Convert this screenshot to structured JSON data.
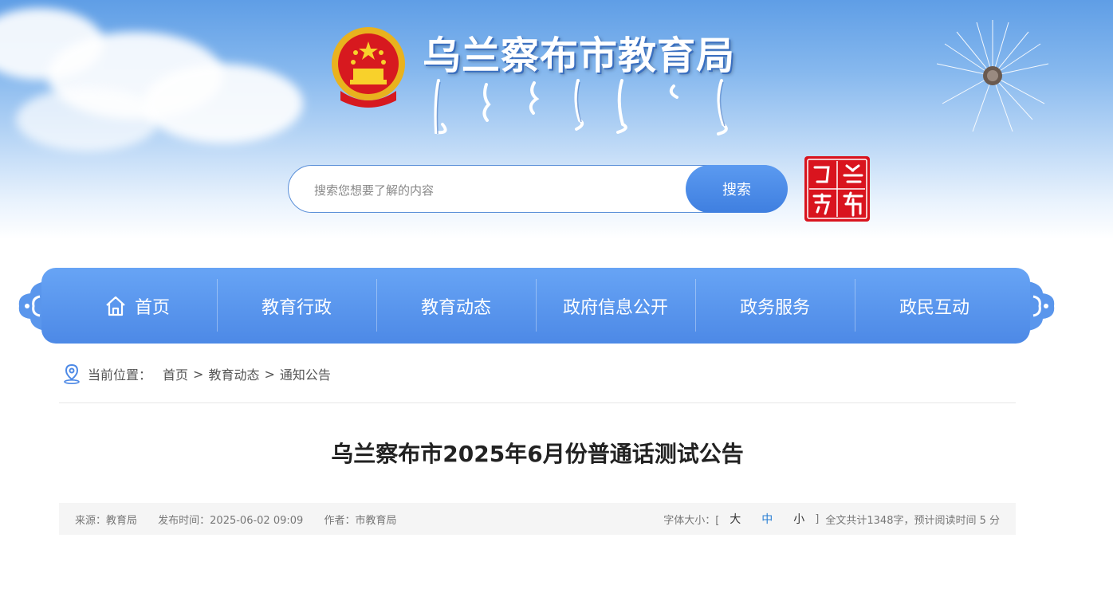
{
  "header": {
    "site_title": "乌兰察布市教育局",
    "seal_chars": [
      "乌",
      "兰",
      "察",
      "布"
    ]
  },
  "search": {
    "placeholder": "搜索您想要了解的内容",
    "button_label": "搜索"
  },
  "nav": {
    "items": [
      {
        "label": "首页",
        "icon": "home-icon"
      },
      {
        "label": "教育行政"
      },
      {
        "label": "教育动态"
      },
      {
        "label": "政府信息公开"
      },
      {
        "label": "政务服务"
      },
      {
        "label": "政民互动"
      }
    ]
  },
  "breadcrumb": {
    "prefix": "当前位置：",
    "items": [
      "首页",
      "教育动态",
      "通知公告"
    ],
    "separator": ">"
  },
  "article": {
    "title": "乌兰察布市2025年6月份普通话测试公告",
    "source": "来源：教育局",
    "publish_time": "发布时间：2025-06-02 09:09",
    "author": "作者：市教育局",
    "font_size_label": "字体大小：[",
    "font_size_close": "]",
    "font_sizes": [
      "大",
      "中",
      "小"
    ],
    "active_font_size": "中",
    "reading_info": "全文共计1348字，预计阅读时间 5 分"
  },
  "colors": {
    "nav_bg": "#5a96ec",
    "accent": "#2a7fd4",
    "seal_red": "#d9141e"
  }
}
